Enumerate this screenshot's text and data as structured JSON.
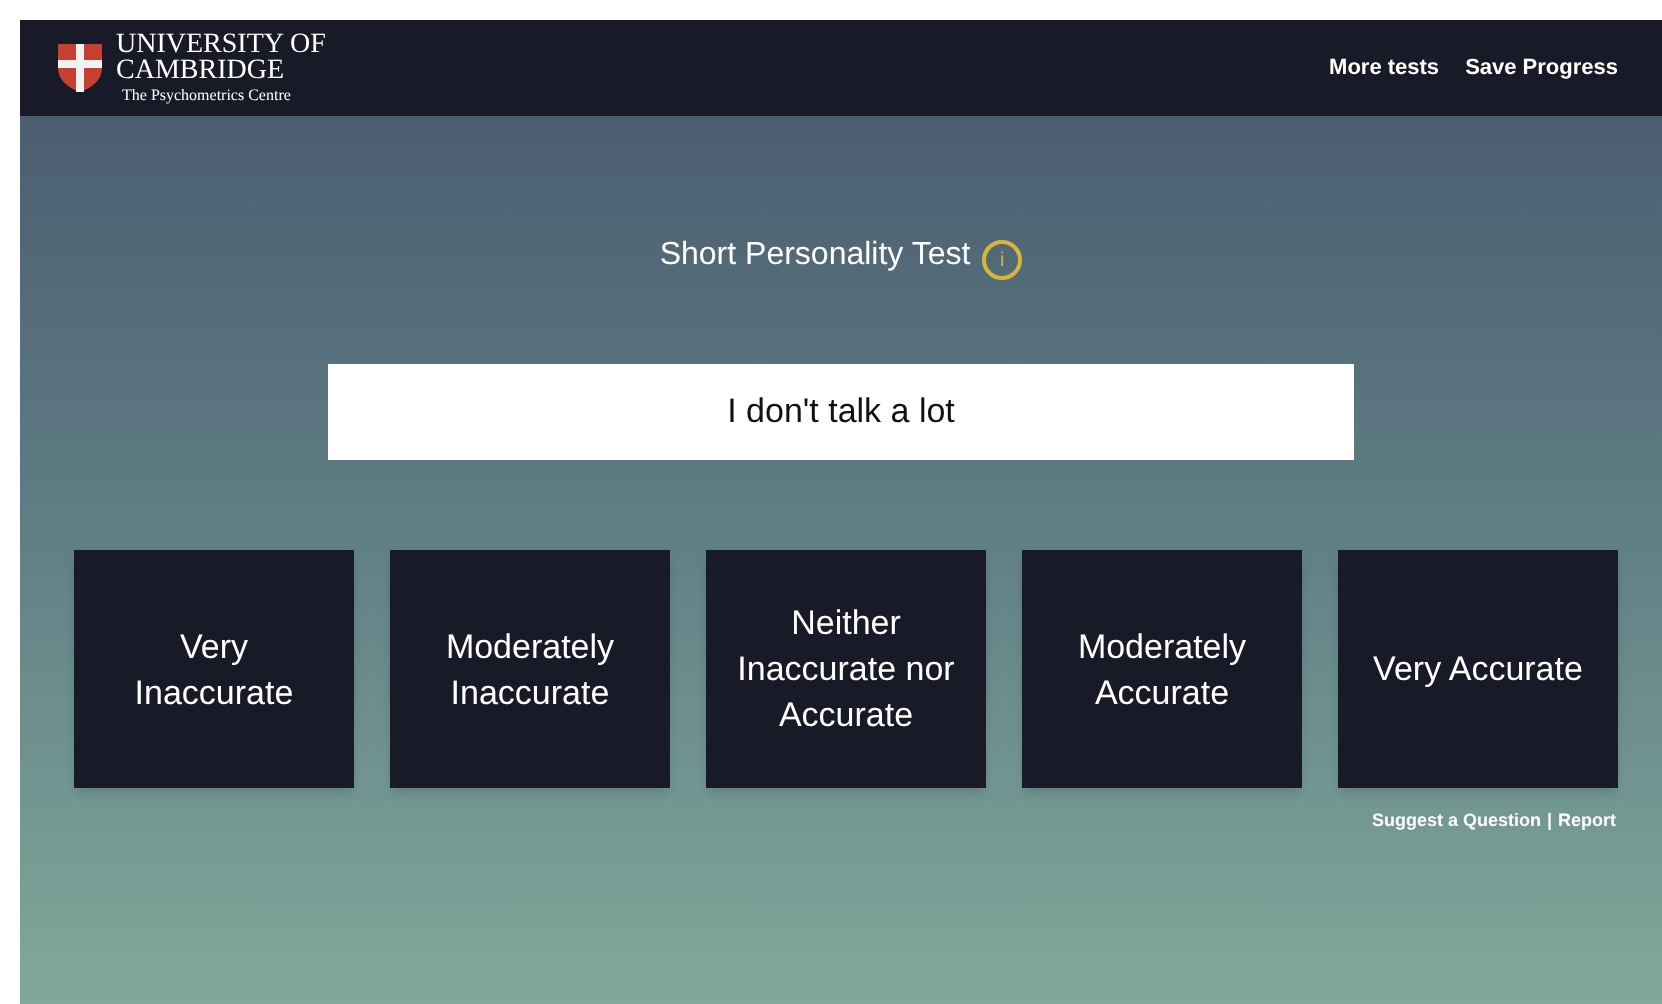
{
  "header": {
    "logo_lines": [
      "UNIVERSITY OF",
      "CAMBRIDGE"
    ],
    "logo_subtitle": "The Psychometrics Centre",
    "nav": [
      "More tests",
      "Save Progress"
    ]
  },
  "test": {
    "title": "Short Personality Test",
    "info": "i"
  },
  "statement": "I don't talk a lot",
  "options": [
    "Very Inaccurate",
    "Moderately Inaccurate",
    "Neither Inaccurate nor Accurate",
    "Moderately Accurate",
    "Very Accurate"
  ],
  "footer_links": {
    "items": [
      "Suggest a Question",
      "Report"
    ],
    "separator": "|"
  }
}
